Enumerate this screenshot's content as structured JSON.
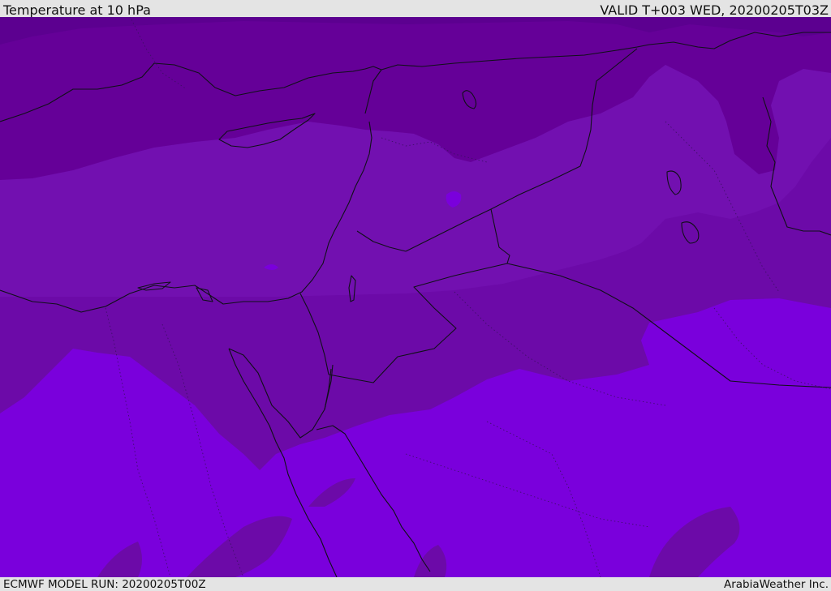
{
  "header": {
    "title": "Temperature at 10 hPa",
    "valid_time": "VALID T+003 WED, 20200205T03Z"
  },
  "footer": {
    "model_run": "ECMWF MODEL RUN: 20200205T00Z",
    "credit": "ArabiaWeather Inc."
  },
  "map": {
    "variable": "Temperature",
    "level": "10 hPa",
    "colors": {
      "band_coldest": "#5c0090",
      "band_1": "#650098",
      "band_2": "#7210b0",
      "band_3": "#6c0aa8",
      "band_warmest": "#7a00dc",
      "coastline": "#101018",
      "borders": "#101018",
      "admin_borders": "#3a1060"
    }
  }
}
